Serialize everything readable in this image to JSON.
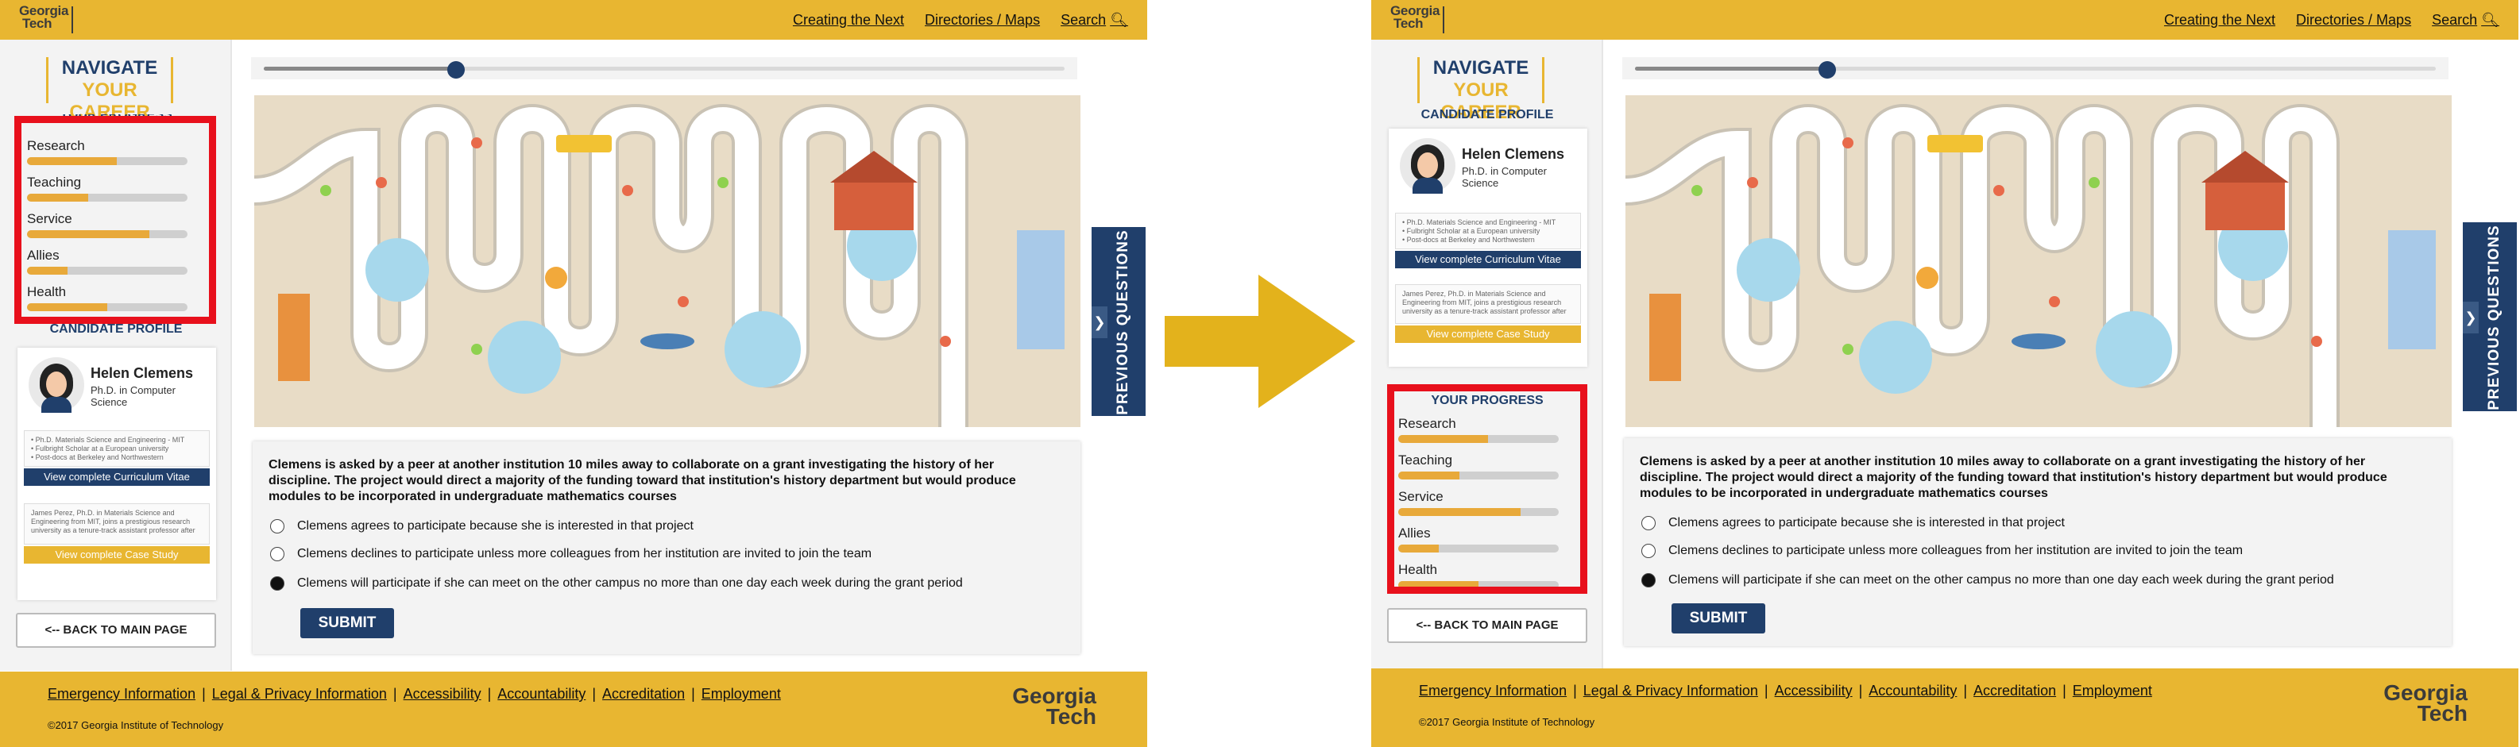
{
  "brand": {
    "logo_line1": "Georgia",
    "logo_line2": "Tech"
  },
  "topnav": {
    "items": [
      "Creating the Next",
      "Directories / Maps"
    ],
    "search": "Search"
  },
  "sidebar": {
    "title_line1": "NAVIGATE",
    "title_line2": "YOUR CAREER",
    "progress_title": "YOUR PROGRESS",
    "profile_title": "CANDIDATE PROFILE",
    "progress": [
      {
        "label": "Research",
        "value": 0.56
      },
      {
        "label": "Teaching",
        "value": 0.38
      },
      {
        "label": "Service",
        "value": 0.76
      },
      {
        "label": "Allies",
        "value": 0.25
      },
      {
        "label": "Health",
        "value": 0.5
      }
    ],
    "profile": {
      "name": "Helen Clemens",
      "title": "Ph.D. in Computer Science",
      "cv_summary": "• Ph.D. Materials Science and Engineering - MIT\n• Fulbright Scholar at a European university\n• Post-docs at Berkeley and Northwestern",
      "cv_button": "View complete Curriculum Vitae",
      "case_summary": "James Perez, Ph.D. in Materials Science and Engineering from MIT, joins a prestigious research university as a tenure-track assistant professor after",
      "case_button": "View complete Case Study"
    },
    "back_button": "<-- BACK TO MAIN PAGE"
  },
  "slider": {
    "value": 0.24
  },
  "question": {
    "text": "Clemens is asked by a peer at another institution 10 miles away to collaborate on a grant investigating the history of her discipline. The project would direct a majority of the funding toward that institution's history department but would produce modules to be incorporated in undergraduate mathematics courses",
    "options": [
      {
        "text": "Clemens agrees to participate because she is interested in that project",
        "selected": false
      },
      {
        "text": "Clemens declines to participate unless more colleagues from her institution are invited to join the team",
        "selected": false
      },
      {
        "text": "Clemens will participate if she can meet on the other campus no more than one day each week during the grant period",
        "selected": true
      }
    ],
    "submit": "SUBMIT"
  },
  "previous_questions": "PREVIOUS QUESTIONS",
  "footer": {
    "links": [
      "Emergency Information",
      "Legal & Privacy Information",
      "Accessibility",
      "Accountability",
      "Accreditation",
      "Employment"
    ],
    "copyright": "©2017 Georgia Institute of Technology"
  },
  "colors": {
    "gold": "#e8b631",
    "navy": "#203f6b",
    "highlight_red": "#e8101c",
    "progress_fill": "#e8a93a"
  }
}
